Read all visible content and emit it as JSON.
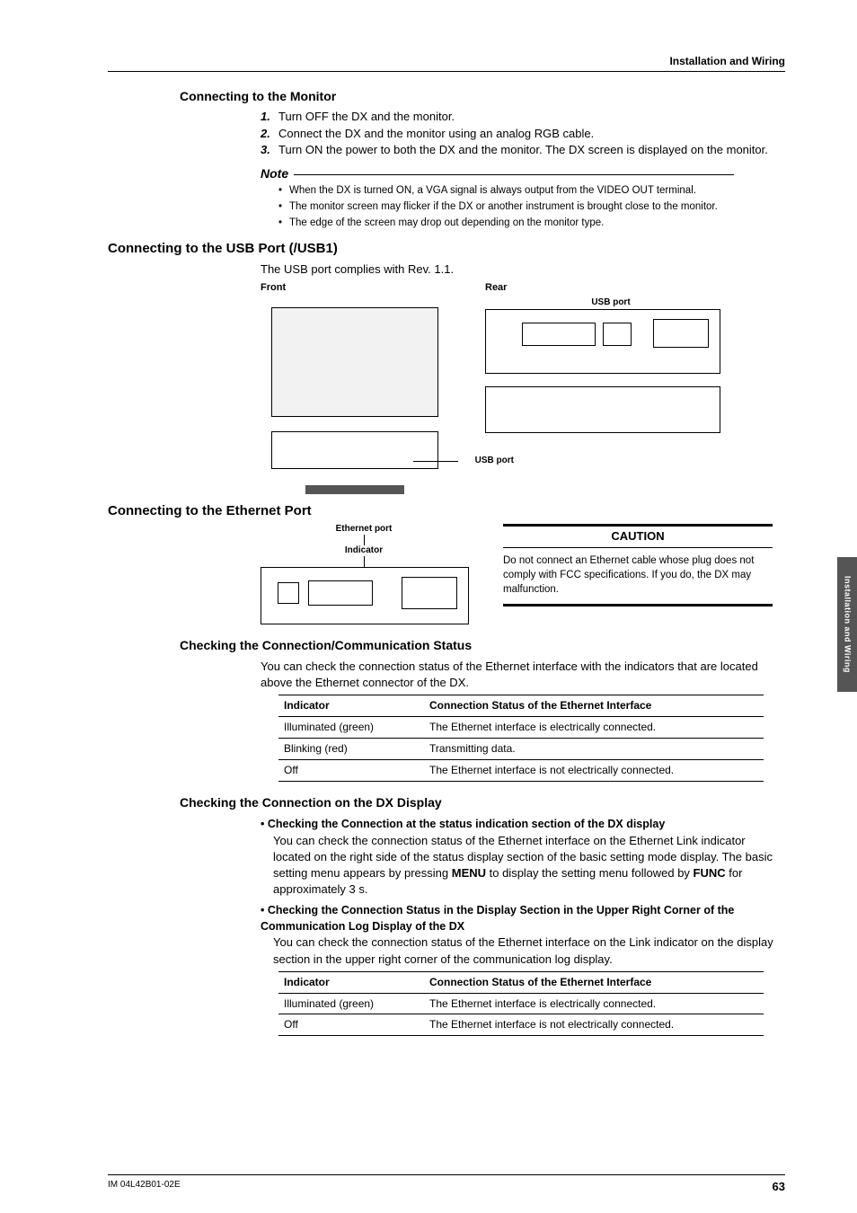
{
  "header": {
    "section": "Installation and Wiring"
  },
  "s1": {
    "title": "Connecting to the Monitor",
    "steps": [
      "Turn OFF the DX and the monitor.",
      "Connect the DX and the monitor using an analog RGB cable.",
      "Turn ON the power to both the DX and the monitor. The DX screen is displayed on the monitor."
    ]
  },
  "note": {
    "label": "Note",
    "items": [
      "When the DX is turned ON, a VGA signal is always output from the VIDEO OUT terminal.",
      "The monitor screen may flicker if the DX or another instrument is brought close to the monitor.",
      "The edge of the screen may drop out depending on the monitor type."
    ]
  },
  "s2": {
    "title": "Connecting to the USB Port (/USB1)",
    "intro": "The USB port complies with Rev. 1.1.",
    "front_label": "Front",
    "rear_label": "Rear",
    "usb_port_label": "USB port"
  },
  "s3": {
    "title": "Connecting to the Ethernet Port",
    "eth_port_label": "Ethernet port",
    "indicator_label": "Indicator",
    "caution_title": "CAUTION",
    "caution_body": "Do not connect an Ethernet cable whose plug does not comply with FCC specifications. If you do, the DX may malfunction."
  },
  "s4": {
    "title": "Checking the Connection/Communication Status",
    "intro": "You can check the connection status of the Ethernet interface with the indicators that are located above the Ethernet connector of the DX.",
    "table": {
      "head": [
        "Indicator",
        "Connection Status of the Ethernet Interface"
      ],
      "rows": [
        [
          "Illuminated (green)",
          "The Ethernet interface is electrically connected."
        ],
        [
          "Blinking (red)",
          "Transmitting data."
        ],
        [
          "Off",
          "The Ethernet interface is not electrically connected."
        ]
      ]
    }
  },
  "s5": {
    "title": "Checking the Connection on the DX Display",
    "b1": {
      "head": "Checking the Connection at the status indication section of the DX display",
      "body_pre": "You can check the connection status of the Ethernet interface on the Ethernet Link indicator located on the right side of the status display section of the basic setting mode display. The basic setting menu appears by pressing ",
      "menu": "MENU",
      "body_mid": " to display the setting menu followed by ",
      "func": "FUNC",
      "body_post": " for approximately 3 s."
    },
    "b2": {
      "head": "Checking the Connection Status in the Display Section in the Upper Right Corner of the Communication Log Display of the DX",
      "body": "You can check the connection status of the Ethernet interface on the Link indicator on the display section in the upper right corner of the communication log display."
    },
    "table": {
      "head": [
        "Indicator",
        "Connection Status of the Ethernet Interface"
      ],
      "rows": [
        [
          "Illuminated (green)",
          "The Ethernet interface is electrically connected."
        ],
        [
          "Off",
          "The Ethernet interface is not electrically connected."
        ]
      ]
    }
  },
  "sidetab": "Installation and Wiring",
  "footer": {
    "doc": "IM 04L42B01-02E",
    "page": "63"
  }
}
